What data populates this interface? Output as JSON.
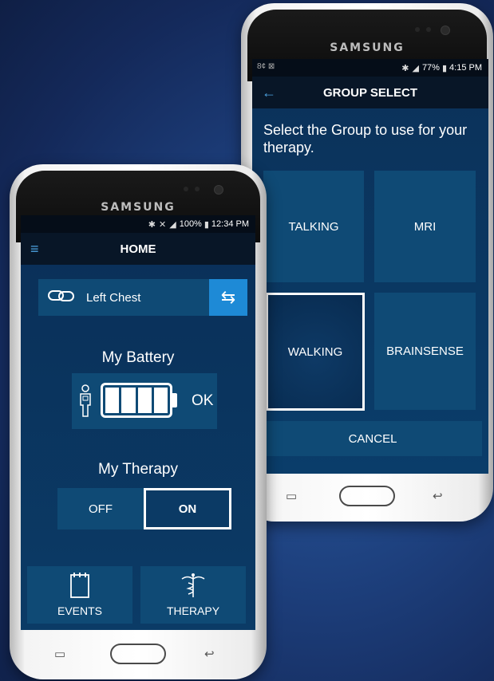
{
  "back_phone": {
    "brand": "SAMSUNG",
    "status_time": "4:15 PM",
    "status_battery": "77%",
    "status_left": "8¢ ⊠",
    "title": "GROUP SELECT",
    "prompt": "Select the Group to use for your therapy.",
    "groups": [
      "TALKING",
      "MRI",
      "WALKING",
      "BRAINSENSE"
    ],
    "selected_group": "WALKING",
    "cancel_label": "CANCEL"
  },
  "front_phone": {
    "brand": "SAMSUNG",
    "status_time": "12:34 PM",
    "status_battery": "100%",
    "title": "HOME",
    "device_location": "Left Chest",
    "battery_title": "My Battery",
    "battery_status": "OK",
    "therapy_title": "My Therapy",
    "therapy_off": "OFF",
    "therapy_on": "ON",
    "therapy_state": "ON",
    "events_label": "EVENTS",
    "therapy_label": "THERAPY"
  },
  "icons": {
    "back_arrow": "back-arrow-icon",
    "menu": "hamburger-menu-icon",
    "link": "link-icon",
    "swap": "swap-icon",
    "person": "person-icon",
    "calendar": "calendar-icon",
    "caduceus": "caduceus-icon"
  },
  "colors": {
    "accent": "#1e8ad6",
    "tile": "#0f4a75",
    "screen": "#0b3a5e",
    "appbar": "#081627"
  }
}
